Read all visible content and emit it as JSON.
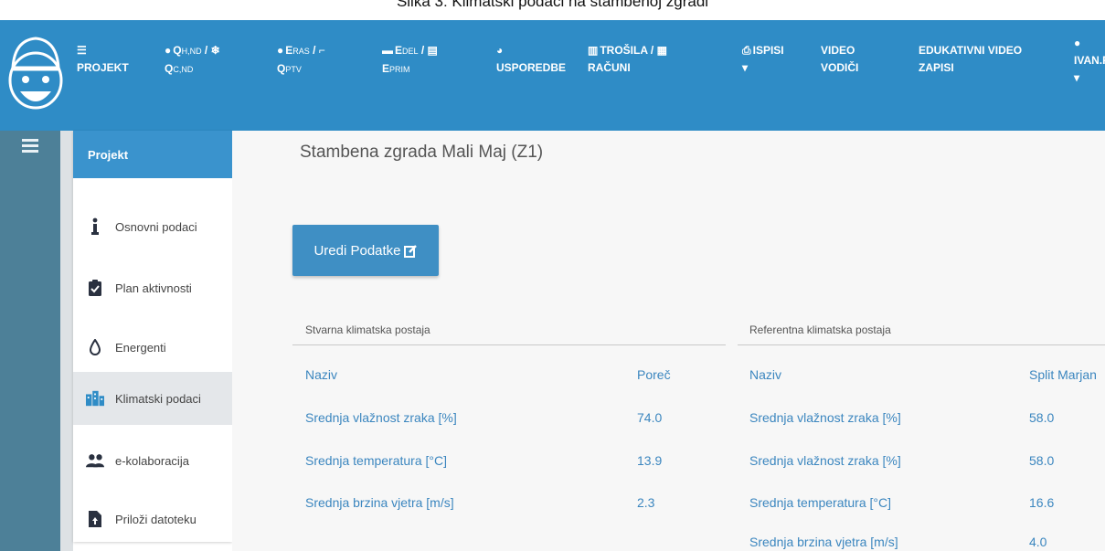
{
  "caption": "Slika 3: Klimatski podaci na stambenoj zgradi",
  "colors": {
    "navbar": "#2f8cc6",
    "accent": "#3a93cd",
    "link": "#3b86bf",
    "strip": "#4d8098"
  },
  "nav": {
    "logo_icon": "mascot-face-icon",
    "projekt": {
      "icon": "list-icon",
      "label": "PROJEKT"
    },
    "q": {
      "line1": "Q",
      "sub1": "H,ND",
      "sep": " / ",
      "line2": "Q",
      "sub2": "C,ND"
    },
    "e_ras": {
      "line1": "E",
      "sub1": "RAS",
      "sep": " / ",
      "line2": "Q",
      "sub2": "PTV"
    },
    "e_del": {
      "line1": "E",
      "sub1": "DEL",
      "sep": " / ",
      "line2": "E",
      "sub2": "PRIM"
    },
    "usporedbe": {
      "label": "USPOREDBE"
    },
    "trosila": {
      "line1": "TROŠILA / ",
      "line2": "RAČUNI"
    },
    "ispisi": {
      "label": "ISPISI",
      "caret": "▾"
    },
    "video": {
      "line1": "VIDEO",
      "line2": "VODIČI"
    },
    "edukativni": {
      "line1": "EDUKATIVNI VIDEO",
      "line2": "ZAPISI"
    },
    "user": {
      "label": "IVAN.F",
      "caret": "▾"
    }
  },
  "sidebar": {
    "header": "Projekt",
    "items": [
      {
        "label": "Osnovni podaci",
        "icon": "info-icon"
      },
      {
        "label": "Plan aktivnosti",
        "icon": "clipboard-check-icon"
      },
      {
        "label": "Energenti",
        "icon": "drop-icon"
      },
      {
        "label": "Klimatski podaci",
        "icon": "buildings-icon"
      },
      {
        "label": "e-kolaboracija",
        "icon": "users-icon"
      },
      {
        "label": "Priloži datoteku",
        "icon": "file-upload-icon"
      }
    ]
  },
  "main": {
    "title": "Stambena zgrada Mali Maj (Z1)",
    "edit_button": "Uredi Podatke",
    "actual": {
      "heading": "Stvarna klimatska postaja",
      "rows": [
        {
          "label": "Naziv",
          "value": "Poreč"
        },
        {
          "label": "Srednja vlažnost zraka [%]",
          "value": "74.0"
        },
        {
          "label": "Srednja temperatura [°C]",
          "value": "13.9"
        },
        {
          "label": "Srednja brzina vjetra [m/s]",
          "value": "2.3"
        }
      ]
    },
    "reference": {
      "heading": "Referentna klimatska postaja",
      "rows": [
        {
          "label": "Naziv",
          "value": "Split Marjan"
        },
        {
          "label": "Srednja vlažnost zraka [%]",
          "value": "58.0"
        },
        {
          "label": "Srednja vlažnost zraka [%]",
          "value": "58.0"
        },
        {
          "label": "Srednja temperatura [°C]",
          "value": "16.6"
        },
        {
          "label": "Srednja brzina vjetra [m/s]",
          "value": "4.0"
        }
      ]
    }
  }
}
